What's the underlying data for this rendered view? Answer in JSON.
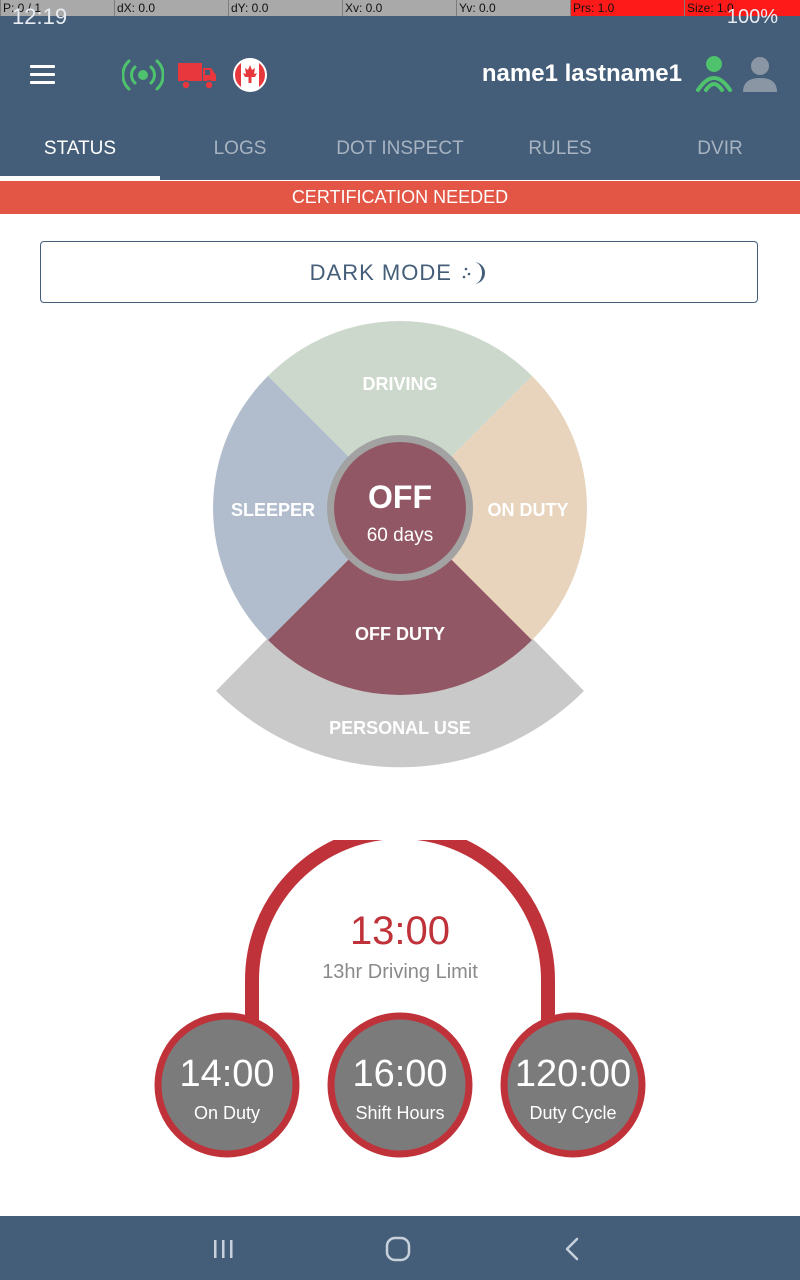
{
  "status_bar": {
    "time": "12:19",
    "battery": "100%",
    "pointer_info": [
      "P: 0 / 1",
      "dX: 0.0",
      "dY: 0.0",
      "Xv: 0.0",
      "Yv: 0.0",
      "Prs: 1.0",
      "Size: 1.0"
    ]
  },
  "header": {
    "user_name": "name1 lastname1",
    "icons": [
      "menu-icon",
      "signal-icon",
      "truck-icon",
      "canada-flag-icon",
      "driver-icon",
      "codriver-icon"
    ]
  },
  "tabs": [
    {
      "label": "STATUS",
      "active": true
    },
    {
      "label": "LOGS",
      "active": false
    },
    {
      "label": "DOT INSPECT",
      "active": false
    },
    {
      "label": "RULES",
      "active": false
    },
    {
      "label": "DVIR",
      "active": false
    }
  ],
  "banner": {
    "text": "CERTIFICATION NEEDED",
    "color": "#e35544"
  },
  "dark_mode": {
    "label": "DARK MODE"
  },
  "status_wheel": {
    "current_status": "OFF",
    "duration": "60 days",
    "segments": {
      "driving": "DRIVING",
      "on_duty": "ON DUTY",
      "sleeper": "SLEEPER",
      "off_duty": "OFF DUTY",
      "personal_use": "PERSONAL USE"
    },
    "colors": {
      "driving": "#cbd8cb",
      "on_duty": "#e8d3bc",
      "sleeper": "#b1bdcd",
      "off_duty": "#925764",
      "personal_use": "#c9c9c9"
    }
  },
  "clocks": {
    "driving": {
      "time": "13:00",
      "label": "13hr Driving Limit"
    },
    "on_duty": {
      "time": "14:00",
      "label": "On Duty"
    },
    "shift": {
      "time": "16:00",
      "label": "Shift Hours"
    },
    "cycle": {
      "time": "120:00",
      "label": "Duty Cycle"
    },
    "accent_color": "#c0323a",
    "dial_color": "#7b7b7b"
  },
  "colors": {
    "primary": "#445e79",
    "tab_inactive": "#a7b3c1",
    "active_signal": "#4ec26c"
  }
}
